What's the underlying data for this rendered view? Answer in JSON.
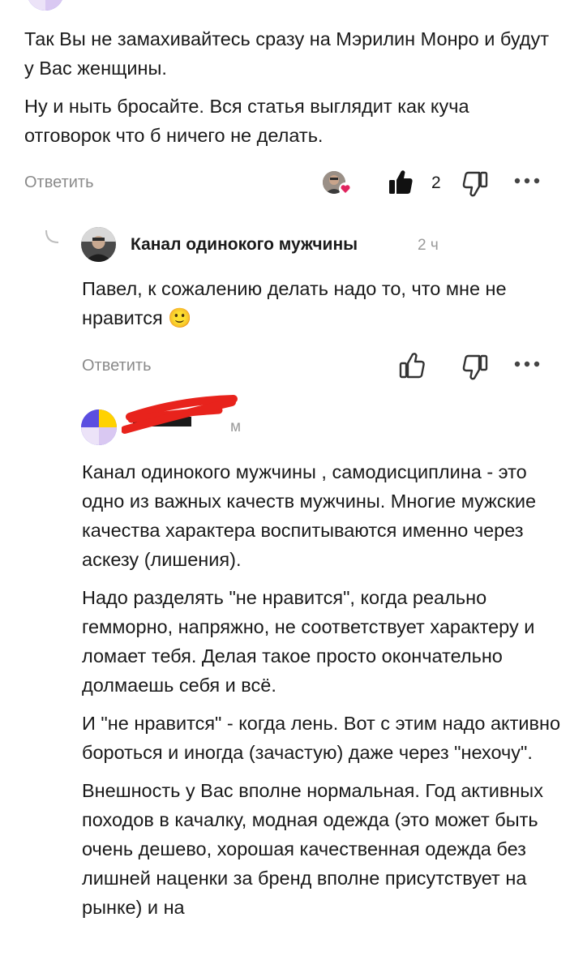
{
  "comment1": {
    "paragraphs": [
      "Так Вы не замахивайтесь сразу на Мэрилин Монро и будут у Вас женщины.",
      "Ну и ныть бросайте. Вся статья выглядит как куча отговорок что б ничего не делать."
    ],
    "reply_label": "Ответить",
    "likes_count": "2",
    "liked": true
  },
  "comment2": {
    "author": "Канал одинокого мужчины",
    "time": "2 ч",
    "text": "Павел, к сожалению делать надо то, что мне не нравится 🙂",
    "reply_label": "Ответить"
  },
  "comment3": {
    "time_partial": "м",
    "paragraphs": [
      "Канал одинокого мужчины , самодисциплина - это одно из важных качеств мужчины. Многие мужские качества характера воспитываются именно через аскезу (лишения).",
      "Надо разделять \"не нравится\", когда реально гемморно, напряжно, не соответствует характеру и ломает тебя. Делая такое просто окончательно долмаешь себя и всё.",
      "И \"не нравится\" - когда лень. Вот с этим надо активно бороться и иногда (зачастую) даже через \"нехочу\".",
      "Внешность у Вас вполне нормальная. Год активных походов в качалку, модная одежда (это может быть очень дешево, хорошая качественная одежда без лишней наценки за бренд вполне присутствует на рынке) и на"
    ]
  },
  "colors": {
    "text": "#1a1a1a",
    "muted": "#8a8a8a",
    "redaction": "#e8231c",
    "avatar_purple": "#5b4ee0",
    "avatar_yellow": "#ffd200",
    "avatar_lilac": "#d9c8f2",
    "heart": "#e0245e"
  },
  "icons": [
    "like-icon",
    "dislike-icon",
    "more-icon",
    "reply-arrow-icon",
    "heart-badge-icon"
  ]
}
